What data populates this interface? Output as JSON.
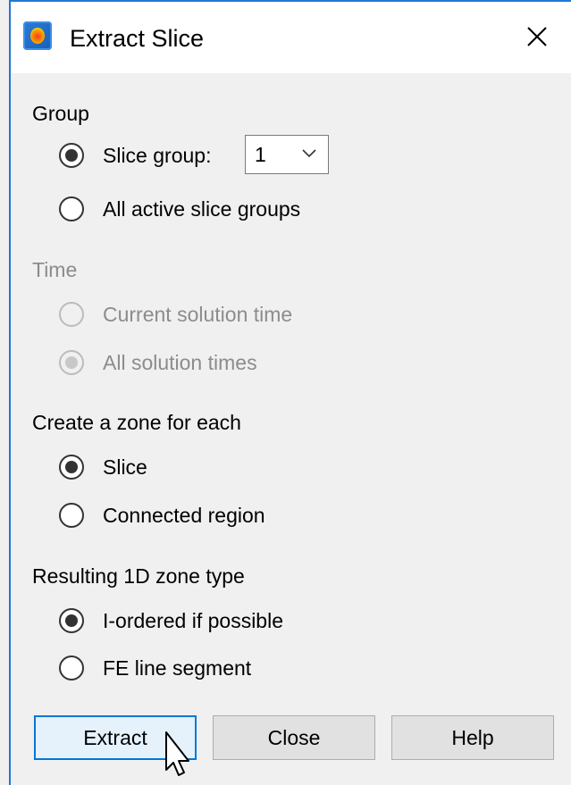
{
  "window": {
    "title": "Extract Slice",
    "icon": "tecplot-app-icon",
    "close_icon": "close-icon"
  },
  "group": {
    "heading": "Group",
    "options": [
      {
        "label": "Slice group:",
        "checked": true
      },
      {
        "label": "All active slice groups",
        "checked": false
      }
    ],
    "slice_group_select": {
      "value": "1"
    }
  },
  "time": {
    "heading": "Time",
    "disabled": true,
    "options": [
      {
        "label": "Current solution time",
        "checked": false
      },
      {
        "label": "All solution times",
        "checked": true
      }
    ]
  },
  "zone_for_each": {
    "heading": "Create a zone for each",
    "options": [
      {
        "label": "Slice",
        "checked": true
      },
      {
        "label": "Connected region",
        "checked": false
      }
    ]
  },
  "zone_type": {
    "heading": "Resulting 1D zone type",
    "options": [
      {
        "label": "I-ordered if possible",
        "checked": true
      },
      {
        "label": "FE line segment",
        "checked": false
      }
    ]
  },
  "buttons": {
    "extract": "Extract",
    "close": "Close",
    "help": "Help"
  },
  "colors": {
    "accent": "#0078d7",
    "window_border": "#1e78d7",
    "dialog_bg": "#f0f0f0",
    "disabled_text": "#8c8c8c"
  }
}
